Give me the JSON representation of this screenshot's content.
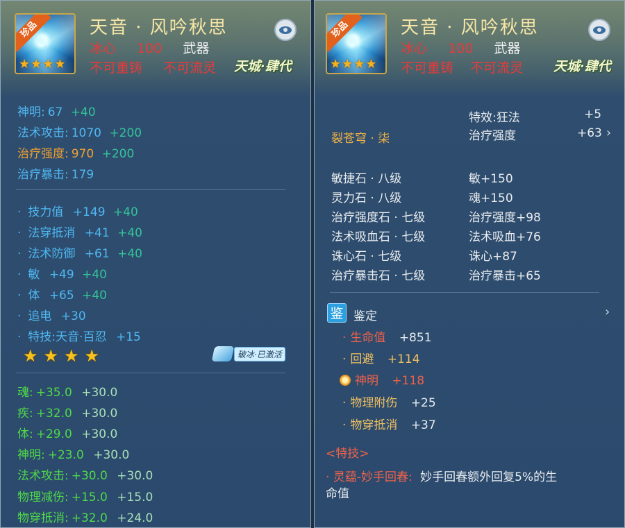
{
  "item": {
    "badge": "珍品",
    "name": "天音 · 风吟秋思",
    "attr_name": "冰心",
    "attr_value": "100",
    "type": "武器",
    "restrict1": "不可重铸",
    "restrict2": "不可流灵",
    "server": "天城·肆代",
    "stars": 4
  },
  "left": {
    "base_stats": [
      {
        "label": "神明:",
        "value": "67",
        "bonus": "+40"
      },
      {
        "label": "法术攻击:",
        "value": "1070",
        "bonus": "+200"
      },
      {
        "label": "治疗强度:",
        "value": "970",
        "bonus": "+200"
      },
      {
        "label": "治疗暴击:",
        "value": "179",
        "bonus": ""
      }
    ],
    "extra_stats": [
      {
        "label": "技力值",
        "value": "+149",
        "bonus": "+40"
      },
      {
        "label": "法穿抵消",
        "value": "+41",
        "bonus": "+40"
      },
      {
        "label": "法术防御",
        "value": "+61",
        "bonus": "+40"
      },
      {
        "label": "敏",
        "value": "+49",
        "bonus": "+40"
      },
      {
        "label": "体",
        "value": "+65",
        "bonus": "+40"
      },
      {
        "label": "追电",
        "value": "+30",
        "bonus": ""
      },
      {
        "label": "特技:天音·百忍",
        "value": "+15",
        "bonus": ""
      }
    ],
    "awaken_stars": 4,
    "activated_label": "破冰·已激活",
    "awaken_stats": [
      {
        "label": "魂:",
        "value": "+35.0",
        "bonus": "+30.0"
      },
      {
        "label": "疾:",
        "value": "+32.0",
        "bonus": "+30.0"
      },
      {
        "label": "体:",
        "value": "+29.0",
        "bonus": "+30.0"
      },
      {
        "label": "神明:",
        "value": "+23.0",
        "bonus": "+30.0"
      },
      {
        "label": "法术攻击:",
        "value": "+30.0",
        "bonus": "+30.0"
      },
      {
        "label": "物理减伤:",
        "value": "+15.0",
        "bonus": "+15.0"
      },
      {
        "label": "物穿抵消:",
        "value": "+32.0",
        "bonus": "+24.0"
      }
    ]
  },
  "right": {
    "effect_label": "特效:狂法",
    "effect_value": "+5",
    "heal_label": "治疗强度",
    "heal_value": "+63",
    "set_name": "裂苍穹 · 柒",
    "gems": [
      {
        "name": "敏捷石 · 八级",
        "effect": "敏+150"
      },
      {
        "name": "灵力石 · 八级",
        "effect": "魂+150"
      },
      {
        "name": "治疗强度石 · 七级",
        "effect": "治疗强度+98"
      },
      {
        "name": "法术吸血石 · 七级",
        "effect": "法术吸血+76"
      },
      {
        "name": "诛心石 · 七级",
        "effect": "诛心+87"
      },
      {
        "name": "治疗暴击石 · 七级",
        "effect": "治疗暴击+65"
      }
    ],
    "appraise_icon": "鉴",
    "appraise_label": "鉴定",
    "appraise_stats": [
      {
        "label": "生命值",
        "value": "+851"
      },
      {
        "label": "回避",
        "value": "+114"
      },
      {
        "label": "神明",
        "value": "+118"
      },
      {
        "label": "物理附伤",
        "value": "+25"
      },
      {
        "label": "物穿抵消",
        "value": "+37"
      }
    ],
    "special_header": "<特技>",
    "special_name": "灵蕴-妙手回春:",
    "special_desc_1": "妙手回春额外回复5%的生",
    "special_desc_2": "命值"
  },
  "colors": {
    "blue": "#4fb8f2",
    "green": "#4fd94a",
    "orange": "#f0a030",
    "red": "#e83a3a",
    "gold": "#f0b347",
    "title": "#f6e6a6"
  },
  "icons": [
    "eye-icon",
    "star-icon",
    "ice-crystal-icon",
    "chevron-right-icon",
    "sun-gem-icon"
  ]
}
